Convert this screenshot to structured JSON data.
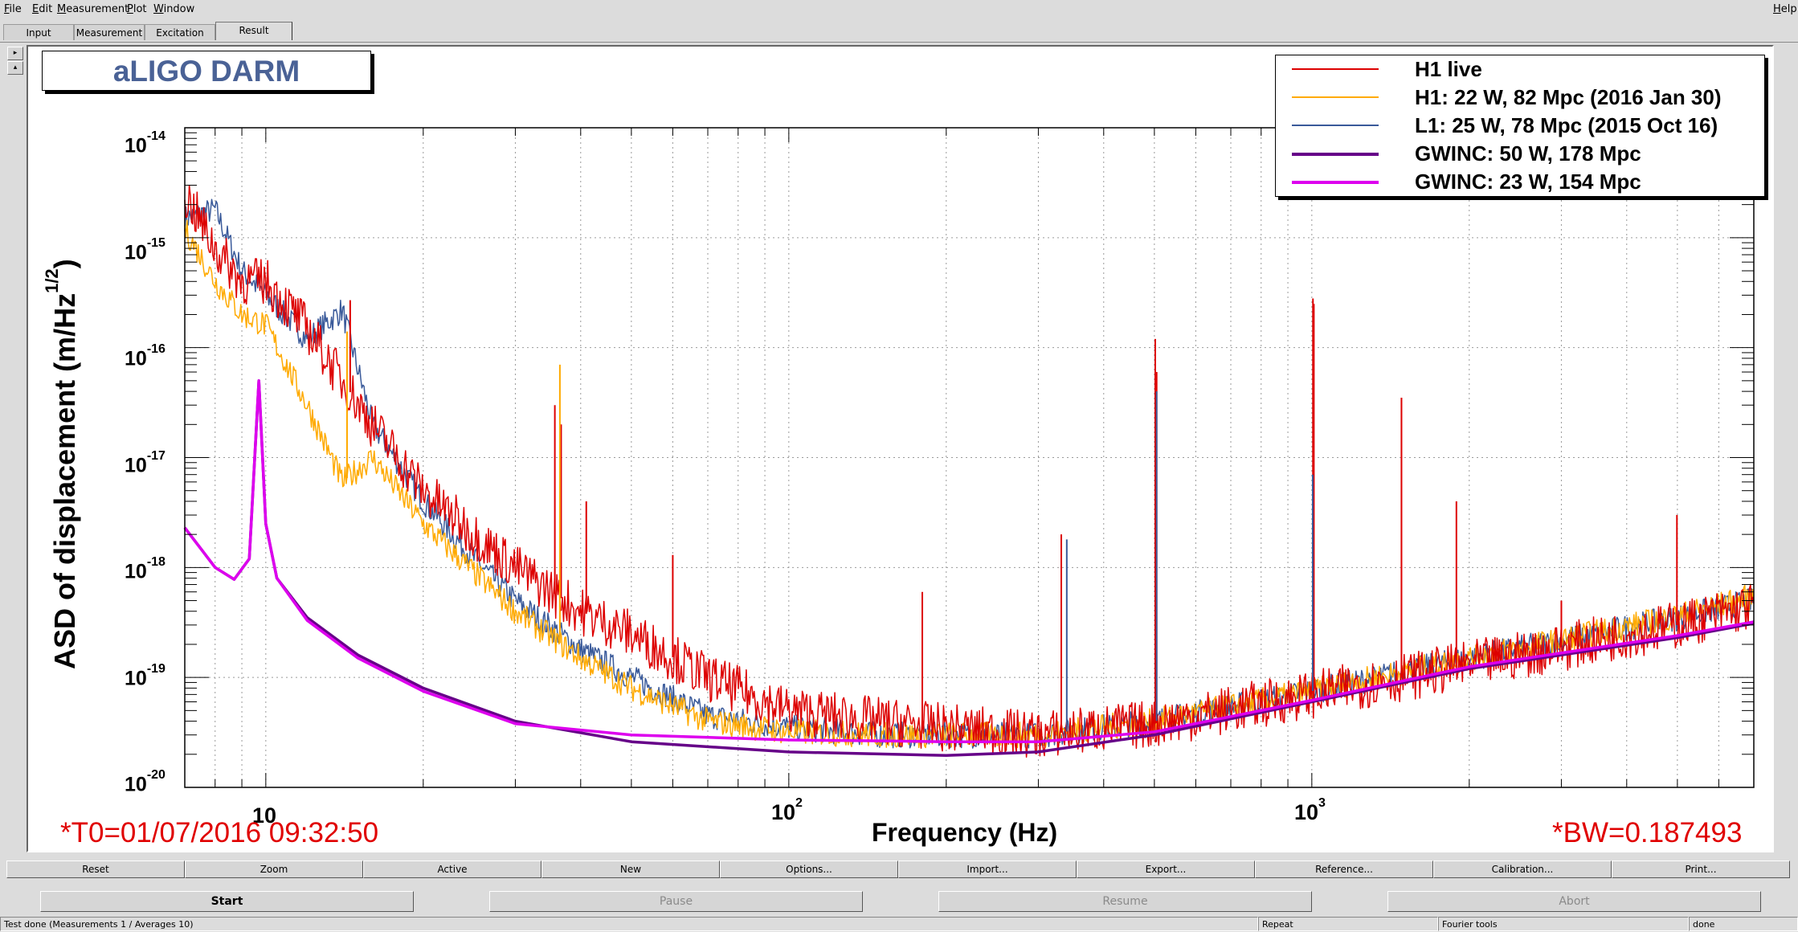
{
  "menu": {
    "items": [
      "File",
      "Edit",
      "Measurement",
      "Plot",
      "Window"
    ],
    "help": "Help"
  },
  "tabs": [
    "Input",
    "Measurement",
    "Excitation",
    "Result"
  ],
  "active_tab": "Result",
  "side_buttons": [
    "▸",
    "▴"
  ],
  "plot": {
    "title": "aLIGO DARM",
    "t0": "*T0=01/07/2016 09:32:50",
    "bw": "*BW=0.187493",
    "xlabel": "Frequency (Hz)",
    "ylabel_main": "ASD of displacement (m/Hz",
    "ylabel_sup": "1/2",
    "ylabel_end": ")",
    "legend": [
      {
        "label": "H1 live",
        "color": "#dd0000",
        "width": 1.5
      },
      {
        "label": "H1: 22 W, 82 Mpc (2016 Jan 30)",
        "color": "#ffaa00",
        "width": 1.5
      },
      {
        "label": "L1: 25 W, 78 Mpc (2015 Oct 16)",
        "color": "#3a5a9a",
        "width": 1.5
      },
      {
        "label": "GWINC: 50 W, 178 Mpc",
        "color": "#660088",
        "width": 3.5
      },
      {
        "label": "GWINC: 23 W, 154 Mpc",
        "color": "#dd00ee",
        "width": 3.5
      }
    ],
    "ytick_base": "10",
    "ytick_exps": [
      "-14",
      "-15",
      "-16",
      "-17",
      "-18",
      "-19",
      "-20"
    ],
    "xtick_labels": [
      {
        "base": "10",
        "exp": ""
      },
      {
        "base": "10",
        "exp": "2"
      },
      {
        "base": "10",
        "exp": "3"
      }
    ]
  },
  "chart_data": {
    "type": "line",
    "title": "aLIGO DARM",
    "xlabel": "Frequency (Hz)",
    "ylabel": "ASD of displacement (m/Hz^1/2)",
    "xscale": "log",
    "yscale": "log",
    "xlim": [
      7,
      7000
    ],
    "ylim": [
      1e-20,
      1e-14
    ],
    "grid": true,
    "legend_position": "top-right",
    "series": [
      {
        "name": "GWINC: 50 W, 178 Mpc",
        "x": [
          7,
          8,
          8.7,
          9.3,
          9.7,
          10.0,
          10.5,
          12,
          15,
          20,
          30,
          50,
          100,
          200,
          300,
          500,
          1000,
          2000,
          5000,
          7000
        ],
        "y": [
          2.3e-18,
          1e-18,
          7.8e-19,
          1.2e-18,
          5e-17,
          2.5e-18,
          8e-19,
          3.5e-19,
          1.6e-19,
          8e-20,
          4e-20,
          2.6e-20,
          2.1e-20,
          1.95e-20,
          2.1e-20,
          3e-20,
          6e-20,
          1.2e-19,
          2.3e-19,
          3.1e-19
        ]
      },
      {
        "name": "GWINC: 23 W, 154 Mpc",
        "x": [
          7,
          8,
          8.7,
          9.3,
          9.7,
          10.0,
          10.5,
          12,
          15,
          20,
          30,
          50,
          100,
          150,
          200,
          300,
          500,
          1000,
          2000,
          5000,
          7000
        ],
        "y": [
          2.3e-18,
          1e-18,
          7.8e-19,
          1.2e-18,
          5e-17,
          2.5e-18,
          8e-19,
          3.3e-19,
          1.5e-19,
          7.5e-20,
          3.8e-20,
          3e-20,
          2.7e-20,
          2.65e-20,
          2.6e-20,
          2.6e-20,
          3.2e-20,
          6.2e-20,
          1.25e-19,
          2.4e-19,
          3.2e-19
        ]
      },
      {
        "name": "L1: 25 W, 78 Mpc (2015 Oct 16)",
        "x": [
          7,
          8,
          9,
          10,
          12,
          14,
          16,
          20,
          25,
          30,
          40,
          50,
          70,
          100,
          150,
          200,
          300,
          500,
          1000,
          2000,
          5000,
          7000
        ],
        "y": [
          1.5e-15,
          1.8e-15,
          5e-16,
          3e-16,
          1.2e-16,
          2.2e-16,
          2e-17,
          4e-18,
          1.2e-18,
          5e-19,
          1.8e-19,
          1e-19,
          4.5e-20,
          3.5e-20,
          3e-20,
          3e-20,
          3e-20,
          4e-20,
          7.5e-20,
          1.5e-19,
          3.5e-19,
          5e-19
        ]
      },
      {
        "name": "H1: 22 W, 82 Mpc (2016 Jan 30)",
        "x": [
          7,
          8,
          9,
          10,
          12,
          14,
          16,
          20,
          25,
          30,
          40,
          50,
          70,
          100,
          150,
          200,
          300,
          500,
          1000,
          2000,
          5000,
          7000
        ],
        "y": [
          1.2e-15,
          4e-16,
          2e-16,
          1.6e-16,
          3e-17,
          6e-18,
          1e-17,
          2.5e-18,
          9e-19,
          4e-19,
          1.5e-19,
          8e-20,
          4e-20,
          3.2e-20,
          3e-20,
          3e-20,
          3e-20,
          4e-20,
          7.5e-20,
          1.5e-19,
          3.6e-19,
          5.5e-19
        ]
      },
      {
        "name": "H1 live",
        "x": [
          7,
          8,
          9,
          10,
          12,
          14,
          16,
          20,
          25,
          30,
          40,
          50,
          70,
          100,
          150,
          200,
          300,
          500,
          1000,
          2000,
          5000,
          7000
        ],
        "y": [
          2.5e-15,
          8e-16,
          4e-16,
          4e-16,
          1.5e-16,
          5e-17,
          2e-17,
          5e-18,
          2e-18,
          1e-18,
          4e-19,
          2.5e-19,
          1e-19,
          5e-20,
          4e-20,
          3.5e-20,
          3e-20,
          3.8e-20,
          7e-20,
          1.3e-19,
          3e-19,
          4.5e-19
        ]
      }
    ],
    "spikes": [
      {
        "name": "H1 live",
        "x": [
          14.5,
          35.7,
          36.7,
          41,
          60,
          180,
          331.9,
          502,
          505,
          1005,
          1009,
          1484,
          1890,
          3000,
          4990
        ],
        "y": [
          2.7e-16,
          3e-17,
          2e-17,
          4e-18,
          1.3e-18,
          6e-19,
          2e-18,
          1.2e-16,
          6e-17,
          2.8e-16,
          2.5e-16,
          3.5e-17,
          4e-18,
          5e-19,
          3e-18
        ]
      },
      {
        "name": "L1: 25 W, 78 Mpc (2015 Oct 16)",
        "x": [
          340,
          505,
          1004
        ],
        "y": [
          1.8e-18,
          4e-17,
          7e-18
        ]
      },
      {
        "name": "H1: 22 W, 82 Mpc (2016 Jan 30)",
        "x": [
          14.3,
          36.5
        ],
        "y": [
          1.4e-16,
          7e-17
        ]
      }
    ]
  },
  "buttons_row1": [
    "Reset",
    "Zoom",
    "Active",
    "New",
    "Options...",
    "Import...",
    "Export...",
    "Reference...",
    "Calibration...",
    "Print..."
  ],
  "buttons_row2": [
    {
      "label": "Start",
      "enabled": true
    },
    {
      "label": "Pause",
      "enabled": false
    },
    {
      "label": "Resume",
      "enabled": false
    },
    {
      "label": "Abort",
      "enabled": false
    }
  ],
  "status": {
    "main": "Test done (Measurements 1 / Averages 10)",
    "repeat": "Repeat",
    "tools": "Fourier tools",
    "state": "done"
  }
}
